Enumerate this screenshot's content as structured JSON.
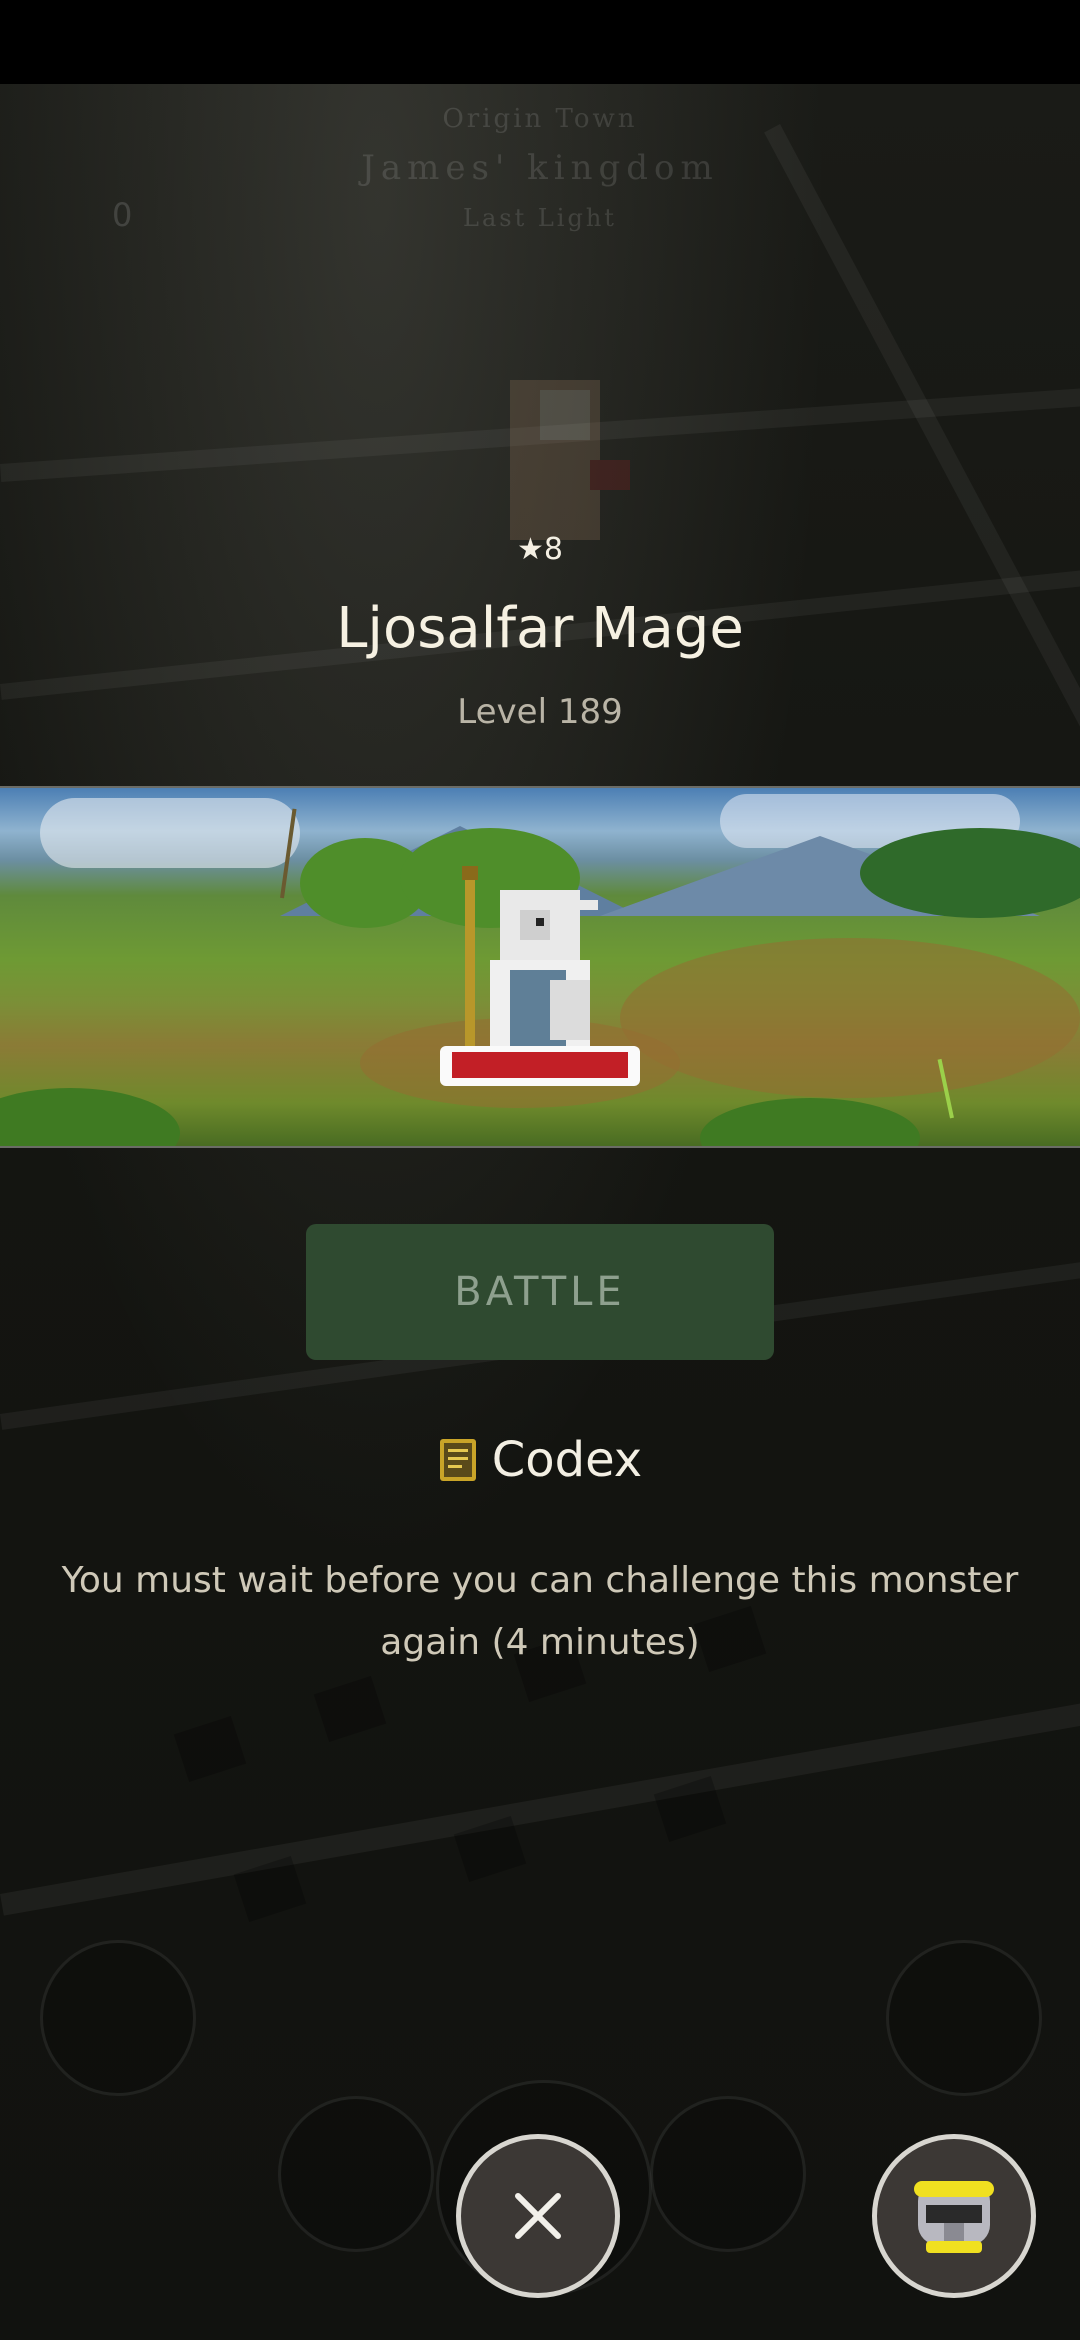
{
  "header": {
    "origin": "Origin Town",
    "kingdom": "James' kingdom",
    "sub": "Last Light",
    "count": "0"
  },
  "monster": {
    "stars": "★8",
    "name": "Ljosalfar Mage",
    "level": "Level 189"
  },
  "actions": {
    "battle_label": "BATTLE",
    "codex_label": "Codex"
  },
  "message": "You must wait before you can challenge this monster again (4 minutes)",
  "icons": {
    "close": "close-icon",
    "helmet": "helmet-icon",
    "codex": "book-icon"
  },
  "colors": {
    "battle_button": "#2f4a30",
    "name_text": "#f6f1e2"
  }
}
